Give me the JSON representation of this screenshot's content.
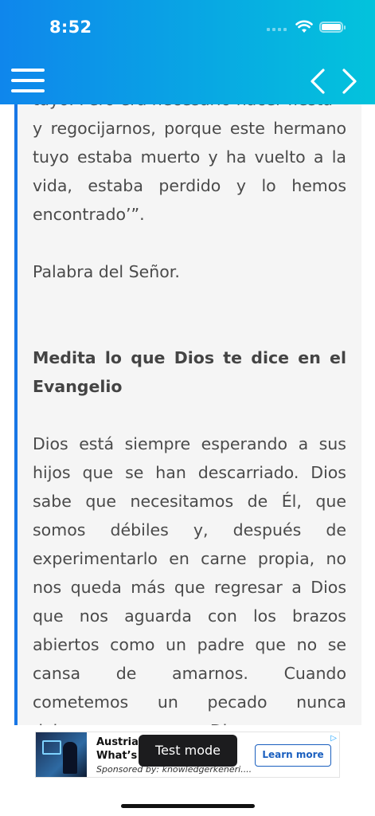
{
  "status_bar": {
    "time": "8:52"
  },
  "header": {
    "menu_icon": "hamburger-menu-icon",
    "prev_icon": "chevron-left-icon",
    "next_icon": "chevron-right-icon",
    "gradient_start": "#0f86ec",
    "gradient_end": "#03c3dc"
  },
  "content": {
    "accent_color": "#1877e6",
    "cut_line": "tuyo. Pero era necesario hacer fiesta",
    "para1": "y regocijarnos, porque este hermano tuyo estaba muerto y ha vuelto a la vida, estaba perdido y lo hemos encontrado’”.",
    "para2": "Palabra del Señor.",
    "heading": "Medita lo que Dios te dice en el Evangelio",
    "para3": "Dios está siempre esperando a sus hijos que se han descarriado. Dios sabe que necesitamos de Él, que somos débiles y, después de experimentarlo en carne propia, no nos queda más que regresar a Dios que nos aguarda con los brazos abiertos como un padre que no se cansa de amarnos. Cuando cometemos un pecado nunca debemos pensar que Dios"
  },
  "ad": {
    "title_line1": "Austria’s",
    "title_line2": "What’s",
    "sponsor": "Sponsored by: knowledgerkeneri....",
    "cta": "Learn more",
    "ad_choice_icon": "ad-choices-icon"
  },
  "toast": {
    "text": "Test mode"
  }
}
